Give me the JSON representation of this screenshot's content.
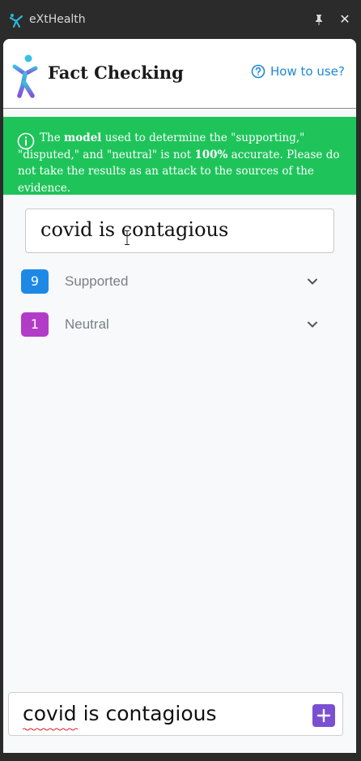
{
  "window": {
    "title": "eXtHealth",
    "icons": {
      "app": "app-logo-icon",
      "pin": "pin-icon",
      "close": "close-icon"
    },
    "close_glyph": "✕"
  },
  "header": {
    "title": "Fact Checking",
    "help_link": "How to use?"
  },
  "notice": {
    "parts": {
      "p1": "The ",
      "b1": "model",
      "p2": " used to determine the \"supporting,\" \"disputed,\" and \"neutral\" is not ",
      "b2": "100%",
      "p3": " accurate. Please do not take the results as an attack to the sources of the evidence."
    }
  },
  "claim": {
    "text": "covid is contagious"
  },
  "results": [
    {
      "count": "9",
      "label": "Supported",
      "color": "#1e88e5"
    },
    {
      "count": "1",
      "label": "Neutral",
      "color": "#b23cc8"
    }
  ],
  "input": {
    "value": "covid is contagious"
  },
  "colors": {
    "accent_green": "#1ec45a",
    "link_blue": "#1e88d4",
    "add_button": "#7a4fd1"
  }
}
